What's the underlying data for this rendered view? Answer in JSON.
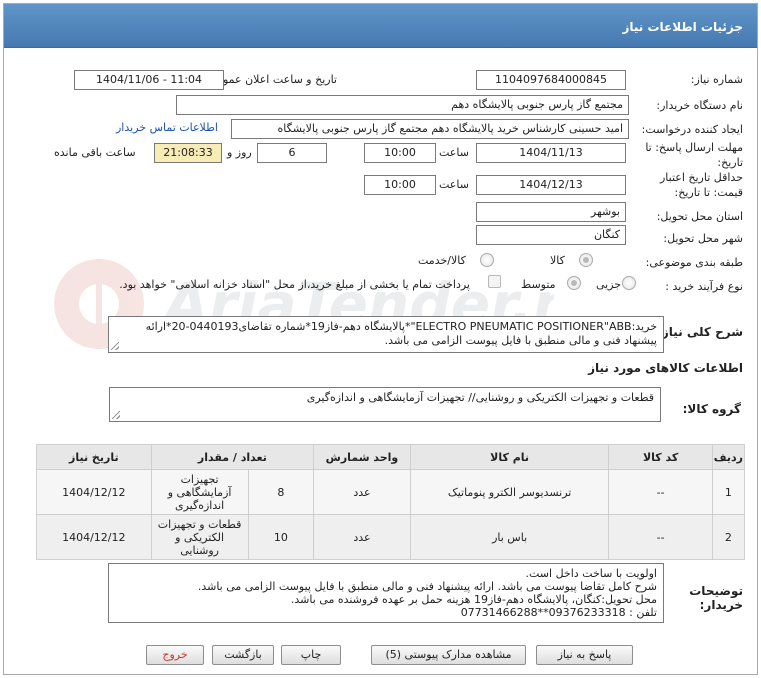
{
  "title": "جزئیات اطلاعات نیاز",
  "fields": {
    "need_number_label": "شماره نیاز:",
    "need_number": "1104097684000845",
    "announce_label": "تاریخ و ساعت اعلان عمومی:",
    "announce_value": "1404/11/06 - 11:04",
    "buyer_org_label": "نام دستگاه خریدار:",
    "buyer_org": "مجتمع گاز پارس جنوبی  پالایشگاه دهم",
    "creator_label": "ایجاد کننده درخواست:",
    "creator": "امید حسینی کارشناس خرید پالایشگاه دهم  مجتمع گاز پارس جنوبی  پالایشگاه",
    "contact_link": "اطلاعات تماس خریدار",
    "deadline_label_1": "مهلت ارسال پاسخ: تا",
    "deadline_label_2": "تاریخ:",
    "deadline_date": "1404/11/13",
    "time_label": "ساعت",
    "deadline_time": "10:00",
    "days_value": "6",
    "days_label": "روز و",
    "remaining_time": "21:08:33",
    "remaining_label": "ساعت باقی مانده",
    "validity_label_1": "حداقل تاریخ اعتبار",
    "validity_label_2": "قیمت: تا تاریخ:",
    "validity_date": "1404/12/13",
    "validity_time": "10:00",
    "province_label": "استان محل تحویل:",
    "province": "بوشهر",
    "city_label": "شهر محل تحویل:",
    "city": "کنگان",
    "category_label": "طبقه بندی موضوعی:",
    "category_options": [
      "کالا",
      "کالا/خدمت"
    ],
    "process_label": "نوع فرآیند خرید :",
    "process_options": [
      "جزیی",
      "متوسط"
    ],
    "payment_note": "پرداخت تمام یا بخشی از مبلغ خرید،از محل \"اسناد خزانه اسلامی\" خواهد بود."
  },
  "description": {
    "label": "شرح کلی نیاز:",
    "text": "خرید:ELECTRO PNEUMATIC POSITIONER\"ABB\"*پالایشگاه دهم-فاز19*شماره تقاضای0440193-20*ارائه پیشنهاد فنی و مالی منطبق با فایل پیوست الزامی می باشد."
  },
  "goods_info_title": "اطلاعات کالاهای مورد نیاز",
  "goods_group": {
    "label": "گروه کالا:",
    "value": "قطعات و تجهیزات الکتریکی و روشنایی// تجهیزات آزمایشگاهی و اندازه‌گیری"
  },
  "table": {
    "headers": [
      "ردیف",
      "کد کالا",
      "نام کالا",
      "واحد شمارش",
      "تعداد / مقدار",
      "تاریخ نیاز"
    ],
    "rows": [
      [
        "1",
        "--",
        "ترنسدیوسر الکترو پنوماتیک",
        "عدد",
        "8",
        "1404/12/12"
      ],
      [
        "2",
        "--",
        "باس بار",
        "عدد",
        "10",
        "1404/12/12"
      ]
    ],
    "row1_group": [
      "تجهیزات",
      "آزمایشگاهی و",
      "اندازه‌گیری"
    ],
    "row2_group": [
      "قطعات و تجهیزات",
      "الکتریکی و",
      "روشنایی"
    ]
  },
  "buyer_notes": {
    "label": "توضیحات",
    "label2": "خریدار:",
    "lines": [
      "اولویت با ساخت داخل است.",
      "شرح کامل تقاضا پیوست می باشد. ارائه پیشنهاد فنی و مالی منطبق با فایل پیوست الزامی می باشد.",
      "محل تحویل:کنگان، پالایشگاه دهم-فاز19 هزینه حمل بر عهده فروشنده می باشد.",
      "تلفن : 09376233318**07731466288"
    ]
  },
  "buttons": {
    "reply": "پاسخ به نیاز",
    "attachments": "مشاهده مدارک پیوستی (5)",
    "print": "چاپ",
    "back": "بازگشت",
    "exit": "خروج"
  },
  "watermark": "AriaTender.net"
}
